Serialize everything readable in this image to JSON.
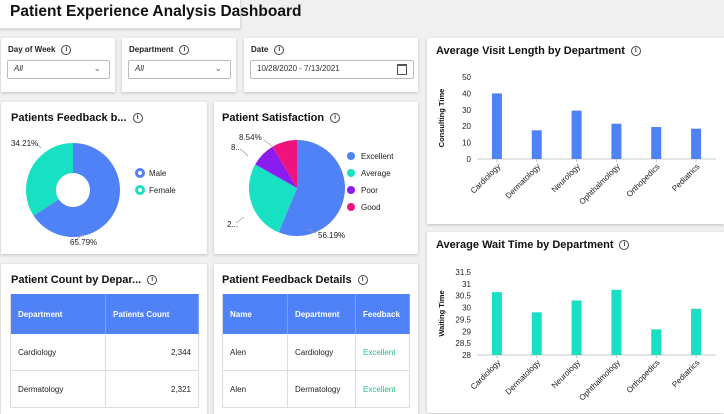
{
  "app": {
    "title": "Patient Experience Analysis Dashboard"
  },
  "filters": {
    "day_of_week": {
      "label": "Day of Week",
      "value": "All"
    },
    "department": {
      "label": "Department",
      "value": "All"
    },
    "date": {
      "label": "Date",
      "value": "10/28/2020 - 7/13/2021"
    }
  },
  "icons": {
    "info": "info-circle-icon",
    "dropdown": "chevron-down-icon",
    "calendar": "calendar-icon"
  },
  "colors": {
    "blue": "#4f82f7",
    "teal": "#18e0c2",
    "purple": "#8a1cf0",
    "pink": "#f0127f",
    "excellent_text": "#1cc47e"
  },
  "feedback_gender": {
    "title": "Patients Feedback b...",
    "legend": [
      "Male",
      "Female"
    ],
    "labels": {
      "male": "65.79%",
      "female": "34.21%"
    }
  },
  "satisfaction": {
    "title": "Patient Satisfaction",
    "legend": [
      "Excellent",
      "Average",
      "Poor",
      "Good"
    ],
    "labels": {
      "excellent": "56.19%",
      "average": "2...",
      "poor": "8...",
      "good": "8.54%"
    }
  },
  "patient_count": {
    "title": "Patient Count by Depar...",
    "columns": [
      "Department",
      "Patients Count"
    ],
    "rows": [
      [
        "Cardiology",
        "2,344"
      ],
      [
        "Dermatology",
        "2,321"
      ]
    ]
  },
  "feedback_details": {
    "title": "Patient Feedback Details",
    "columns": [
      "Name",
      "Department",
      "Feedback"
    ],
    "rows": [
      [
        "Alen",
        "Cardiology",
        "Excellent"
      ],
      [
        "Alen",
        "Dermatology",
        "Excellent"
      ]
    ]
  },
  "chart_data": [
    {
      "type": "pie",
      "title": "Patients Feedback b...",
      "donut": true,
      "categories": [
        "Male",
        "Female"
      ],
      "values": [
        65.79,
        34.21
      ],
      "data_labels": [
        "65.79%",
        "34.21%"
      ],
      "legend_position": "right",
      "colors": [
        "#4f82f7",
        "#18e0c2"
      ]
    },
    {
      "type": "pie",
      "title": "Patient Satisfaction",
      "donut": false,
      "categories": [
        "Excellent",
        "Average",
        "Poor",
        "Good"
      ],
      "values": [
        56.19,
        27.0,
        8.27,
        8.54
      ],
      "data_labels": [
        "56.19%",
        "2...",
        "8...",
        "8.54%"
      ],
      "legend_position": "right",
      "colors": [
        "#4f82f7",
        "#18e0c2",
        "#8a1cf0",
        "#f0127f"
      ]
    },
    {
      "type": "bar",
      "title": "Average Visit Length by Department",
      "categories": [
        "Cardiology",
        "Dermatology",
        "Neurology",
        "Ophthalmology",
        "Orthopedics",
        "Pediatrics"
      ],
      "values": [
        40,
        17.5,
        29.5,
        21.5,
        19.5,
        18.5
      ],
      "ylabel": "Consulting Time",
      "ylim": [
        0,
        50
      ],
      "yticks": [
        "0",
        "10",
        "20",
        "30",
        "40",
        "50"
      ],
      "grid": false,
      "color": "#4f82f7"
    },
    {
      "type": "bar",
      "title": "Average Wait Time by Department",
      "categories": [
        "Cardiology",
        "Dermatology",
        "Neurology",
        "Ophthalmology",
        "Orthopedics",
        "Pediatrics"
      ],
      "values": [
        30.65,
        29.8,
        30.3,
        30.75,
        29.08,
        29.95
      ],
      "ylabel": "Waiting Time",
      "ylim": [
        28,
        31.5
      ],
      "yticks": [
        "28",
        "28.5",
        "29",
        "29.5",
        "30",
        "30.5",
        "31",
        "31.5"
      ],
      "grid": false,
      "color": "#18e0c2"
    }
  ]
}
